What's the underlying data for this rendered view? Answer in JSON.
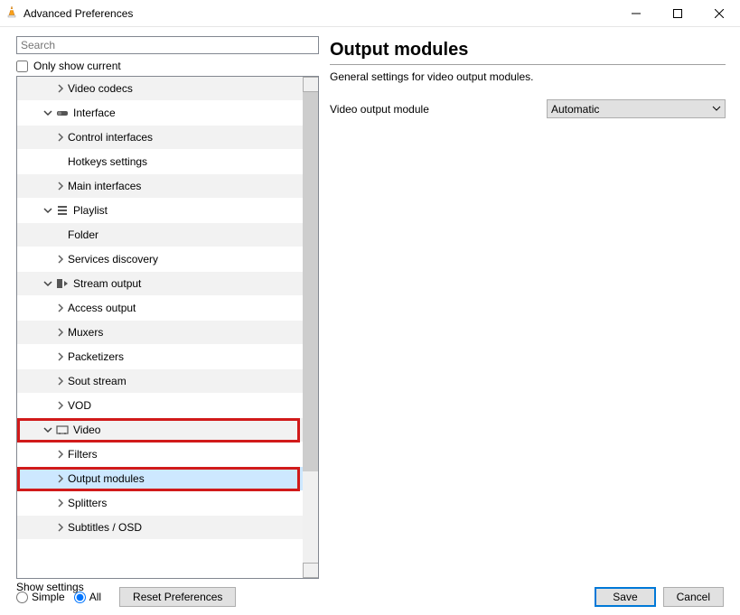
{
  "window": {
    "title": "Advanced Preferences"
  },
  "search": {
    "placeholder": "Search"
  },
  "show_current_label": "Only show current",
  "tree": {
    "items": [
      {
        "label": "Video codecs"
      },
      {
        "label": "Interface"
      },
      {
        "label": "Control interfaces"
      },
      {
        "label": "Hotkeys settings"
      },
      {
        "label": "Main interfaces"
      },
      {
        "label": "Playlist"
      },
      {
        "label": "Folder"
      },
      {
        "label": "Services discovery"
      },
      {
        "label": "Stream output"
      },
      {
        "label": "Access output"
      },
      {
        "label": "Muxers"
      },
      {
        "label": "Packetizers"
      },
      {
        "label": "Sout stream"
      },
      {
        "label": "VOD"
      },
      {
        "label": "Video"
      },
      {
        "label": "Filters"
      },
      {
        "label": "Output modules"
      },
      {
        "label": "Splitters"
      },
      {
        "label": "Subtitles / OSD"
      }
    ]
  },
  "panel": {
    "title": "Output modules",
    "description": "General settings for video output modules.",
    "field_label": "Video output module",
    "field_value": "Automatic"
  },
  "footer": {
    "show_settings": "Show settings",
    "simple": "Simple",
    "all": "All",
    "reset": "Reset Preferences",
    "save": "Save",
    "cancel": "Cancel"
  }
}
